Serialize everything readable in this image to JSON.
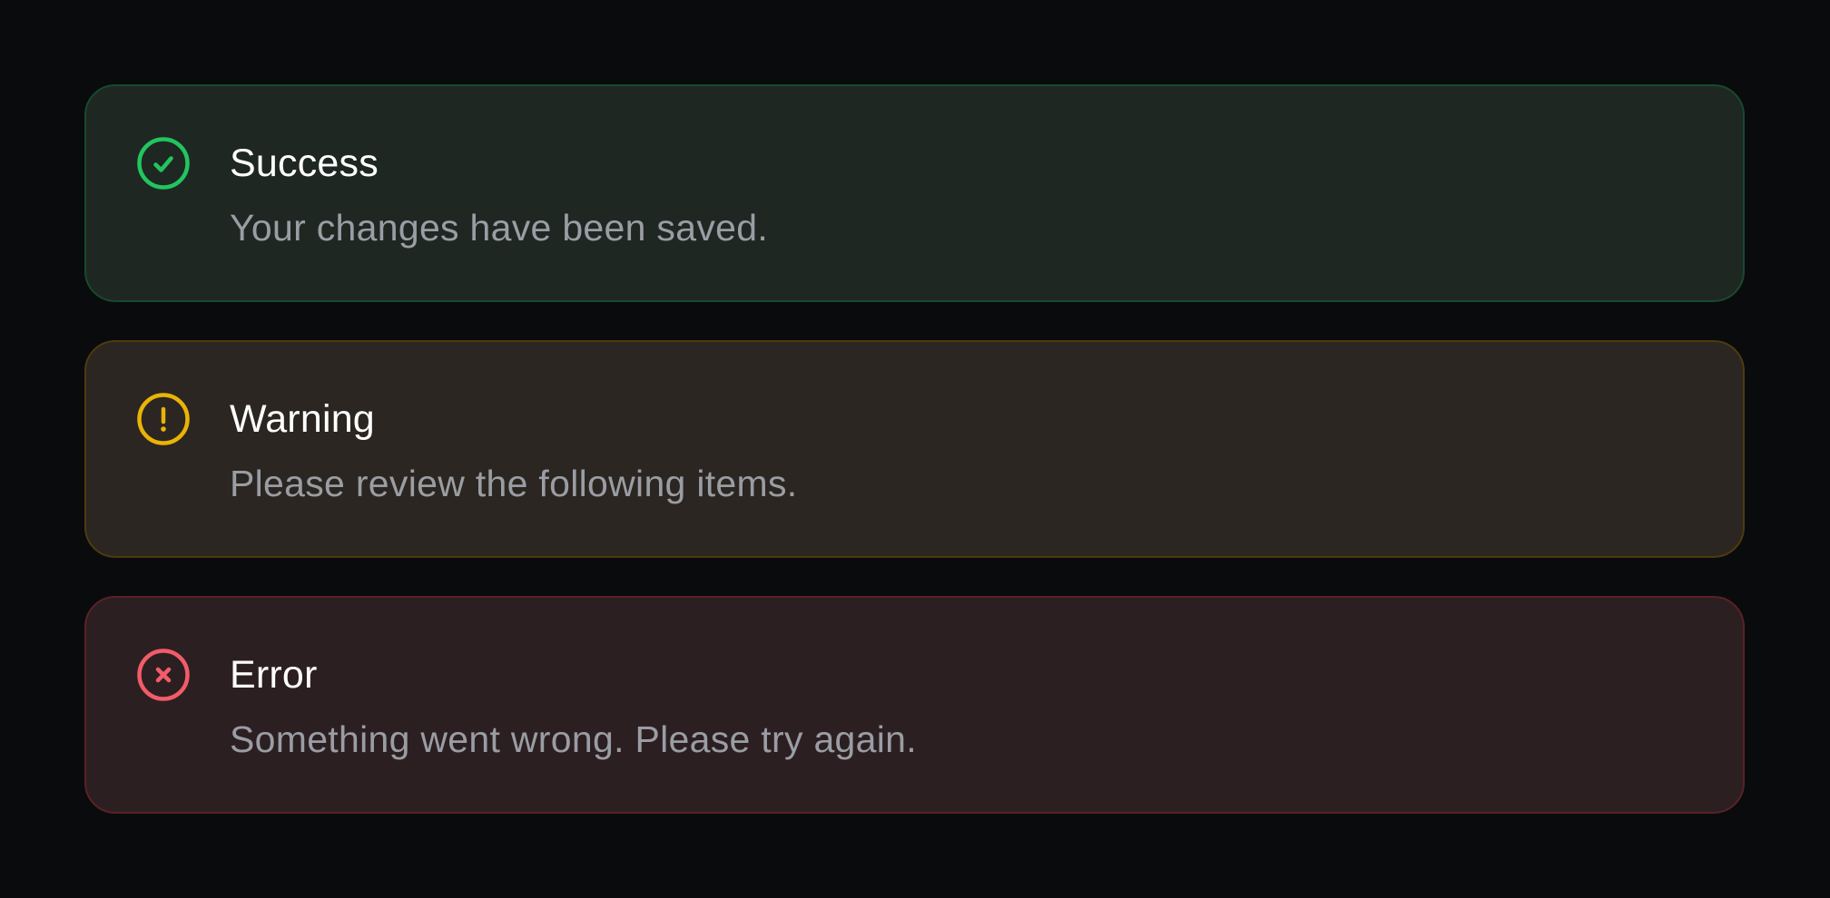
{
  "colors": {
    "background": "#0a0b0d",
    "success_accent": "#22c55e",
    "warning_accent": "#eab308",
    "error_accent": "#f25c69",
    "title_text": "#ffffff",
    "message_text": "#9a9da3"
  },
  "alerts": [
    {
      "variant": "success",
      "icon": "check-circle-icon",
      "title": "Success",
      "message": "Your changes have been saved."
    },
    {
      "variant": "warning",
      "icon": "exclamation-circle-icon",
      "title": "Warning",
      "message": "Please review the following items."
    },
    {
      "variant": "error",
      "icon": "x-circle-icon",
      "title": "Error",
      "message": "Something went wrong. Please try again."
    }
  ]
}
